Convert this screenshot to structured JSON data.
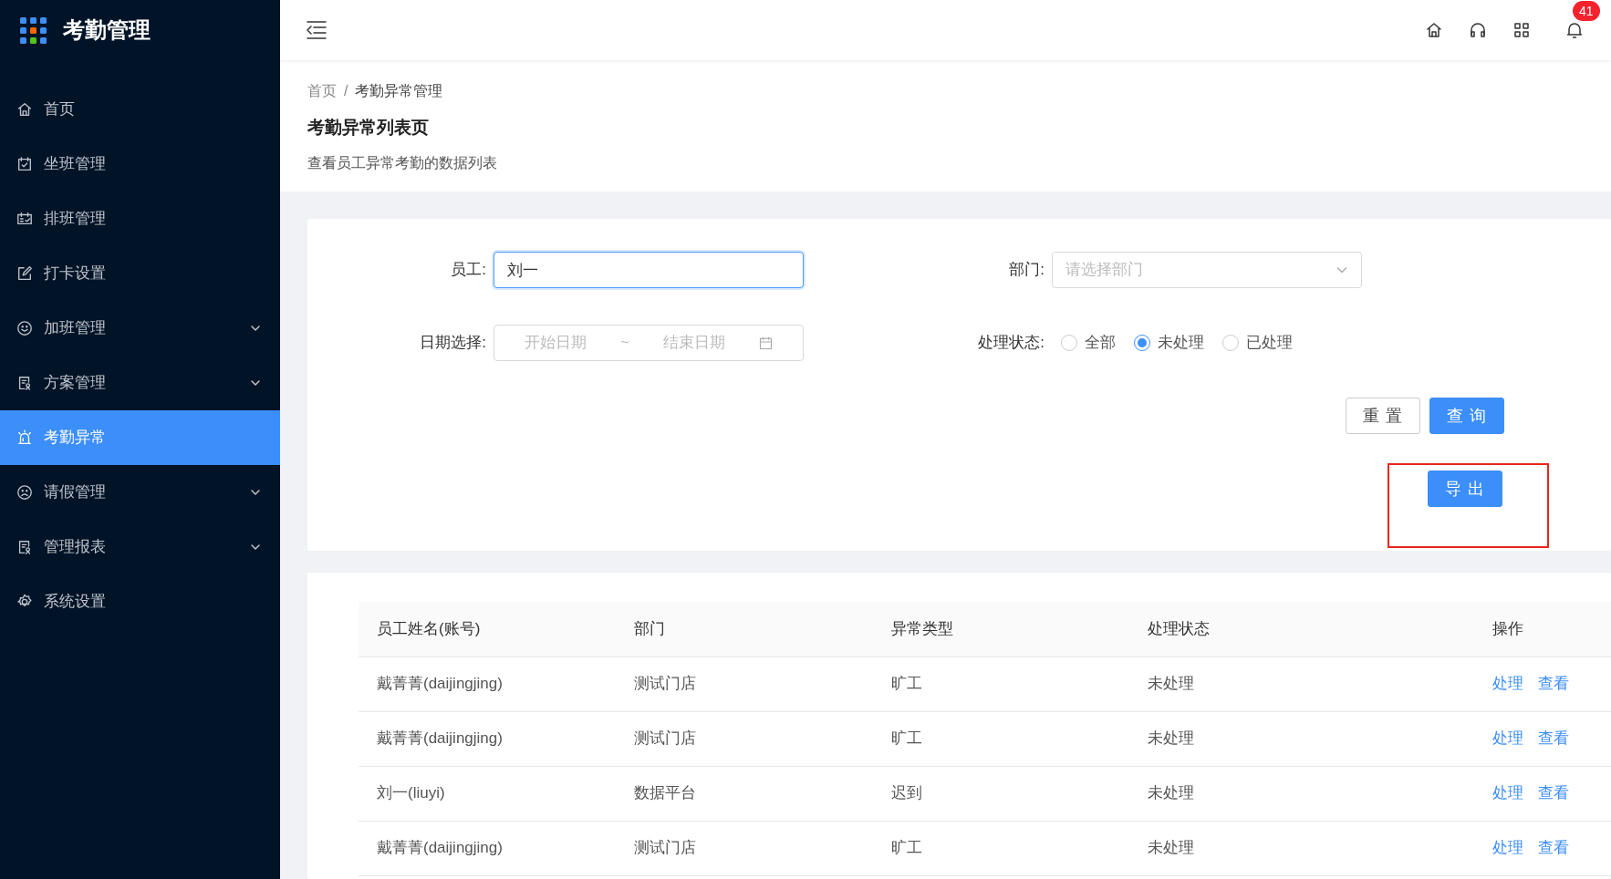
{
  "app": {
    "title": "考勤管理"
  },
  "sidebar": {
    "items": [
      {
        "label": "首页",
        "selected": false,
        "has_submenu": false
      },
      {
        "label": "坐班管理",
        "selected": false,
        "has_submenu": false
      },
      {
        "label": "排班管理",
        "selected": false,
        "has_submenu": false
      },
      {
        "label": "打卡设置",
        "selected": false,
        "has_submenu": false
      },
      {
        "label": "加班管理",
        "selected": false,
        "has_submenu": true
      },
      {
        "label": "方案管理",
        "selected": false,
        "has_submenu": true
      },
      {
        "label": "考勤异常",
        "selected": true,
        "has_submenu": false
      },
      {
        "label": "请假管理",
        "selected": false,
        "has_submenu": true
      },
      {
        "label": "管理报表",
        "selected": false,
        "has_submenu": true
      },
      {
        "label": "系统设置",
        "selected": false,
        "has_submenu": false
      }
    ]
  },
  "header": {
    "notification_count": "41"
  },
  "breadcrumb": {
    "items": [
      "首页",
      "考勤异常管理"
    ],
    "separator": "/"
  },
  "page_header": {
    "title": "考勤异常列表页",
    "description": "查看员工异常考勤的数据列表"
  },
  "filters": {
    "employee": {
      "label": "员工:",
      "value": "刘一",
      "focused": true
    },
    "department": {
      "label": "部门:",
      "placeholder": "请选择部门"
    },
    "date": {
      "label": "日期选择:",
      "start_placeholder": "开始日期",
      "separator": "~",
      "end_placeholder": "结束日期"
    },
    "status": {
      "label": "处理状态:",
      "options": [
        {
          "label": "全部",
          "selected": false
        },
        {
          "label": "未处理",
          "selected": true
        },
        {
          "label": "已处理",
          "selected": false
        }
      ]
    },
    "buttons": {
      "reset": "重 置",
      "query": "查 询"
    },
    "export": {
      "label": "导 出",
      "highlighted": true
    }
  },
  "table": {
    "columns": [
      "员工姓名(账号)",
      "部门",
      "异常类型",
      "处理状态",
      "操作"
    ],
    "rows": [
      {
        "cells": [
          "戴菁菁(daijingjing)",
          "测试门店",
          "旷工",
          "未处理"
        ],
        "actions": [
          "处理",
          "查看"
        ]
      },
      {
        "cells": [
          "戴菁菁(daijingjing)",
          "测试门店",
          "旷工",
          "未处理"
        ],
        "actions": [
          "处理",
          "查看"
        ]
      },
      {
        "cells": [
          "刘一(liuyi)",
          "数据平台",
          "迟到",
          "未处理"
        ],
        "actions": [
          "处理",
          "查看"
        ]
      },
      {
        "cells": [
          "戴菁菁(daijingjing)",
          "测试门店",
          "旷工",
          "未处理"
        ],
        "actions": [
          "处理",
          "查看"
        ]
      }
    ]
  }
}
